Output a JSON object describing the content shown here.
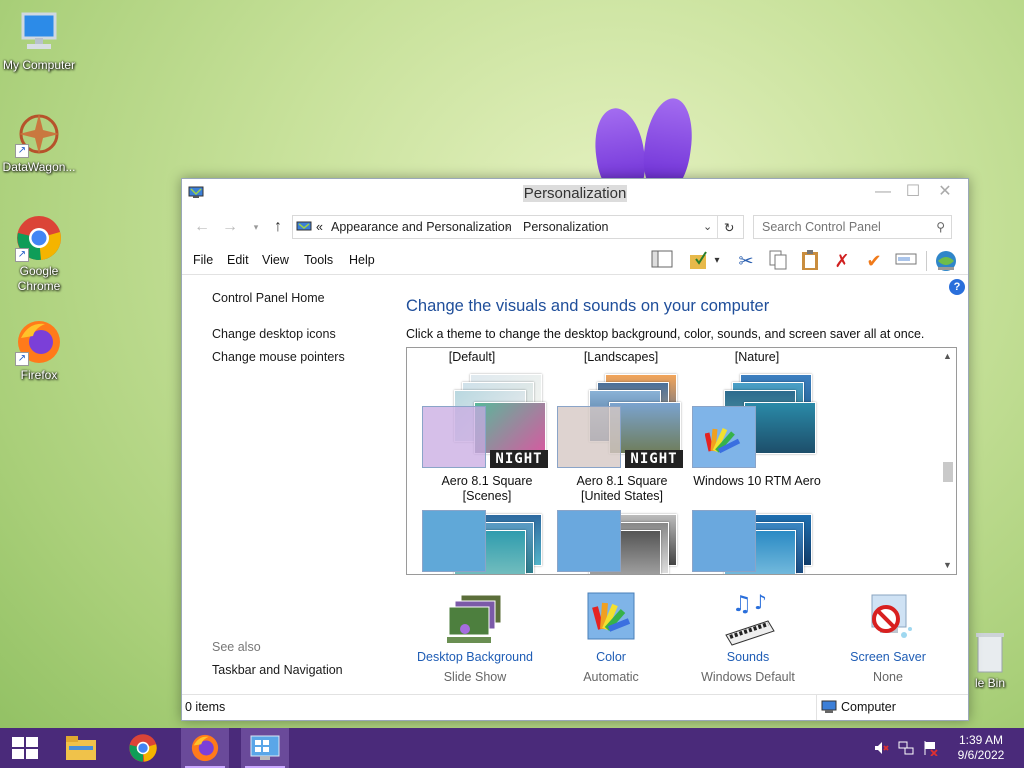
{
  "desktop": {
    "icons": [
      {
        "label": "My Computer",
        "icon": "computer-icon"
      },
      {
        "label": "DataWagon...",
        "icon": "datawagon-icon"
      },
      {
        "label": "Google Chrome",
        "icon": "chrome-icon"
      },
      {
        "label": "Firefox",
        "icon": "firefox-icon"
      },
      {
        "label": "le Bin",
        "icon": "recycle-bin-icon"
      }
    ]
  },
  "window": {
    "title": "Personalization",
    "breadcrumb": {
      "overflow": "«",
      "parent": "Appearance and Personalization",
      "current": "Personalization"
    },
    "search_placeholder": "Search Control Panel",
    "menu": [
      "File",
      "Edit",
      "View",
      "Tools",
      "Help"
    ],
    "left_links": {
      "home": "Control Panel Home",
      "desktop_icons": "Change desktop icons",
      "mouse_pointers": "Change mouse pointers",
      "see_also": "See also",
      "taskbar": "Taskbar and Navigation"
    },
    "heading": "Change the visuals and sounds on your computer",
    "subheading": "Click a theme to change the desktop background, color, sounds, and screen saver all at once.",
    "theme_groups": [
      "[Default]",
      "[Landscapes]",
      "[Nature]"
    ],
    "themes": [
      {
        "name_line1": "Aero 8.1 Square",
        "name_line2": "[Scenes]",
        "badge": "NIGHT"
      },
      {
        "name_line1": "Aero 8.1 Square",
        "name_line2": "[United States]",
        "badge": "NIGHT"
      },
      {
        "name_line1": "Windows 10 RTM Aero",
        "name_line2": "",
        "badge": ""
      }
    ],
    "bottom": [
      {
        "label": "Desktop Background",
        "value": "Slide Show",
        "icon": "desktop-background-icon"
      },
      {
        "label": "Color",
        "value": "Automatic",
        "icon": "color-icon"
      },
      {
        "label": "Sounds",
        "value": "Windows Default",
        "icon": "sounds-icon"
      },
      {
        "label": "Screen Saver",
        "value": "None",
        "icon": "screen-saver-icon"
      }
    ],
    "status": {
      "items": "0 items",
      "location": "Computer"
    }
  },
  "taskbar": {
    "time": "1:39 AM",
    "date": "9/6/2022"
  },
  "colors": {
    "link": "#1f5db5",
    "heading": "#1f4e9a",
    "taskbar": "#4a2a7a"
  }
}
